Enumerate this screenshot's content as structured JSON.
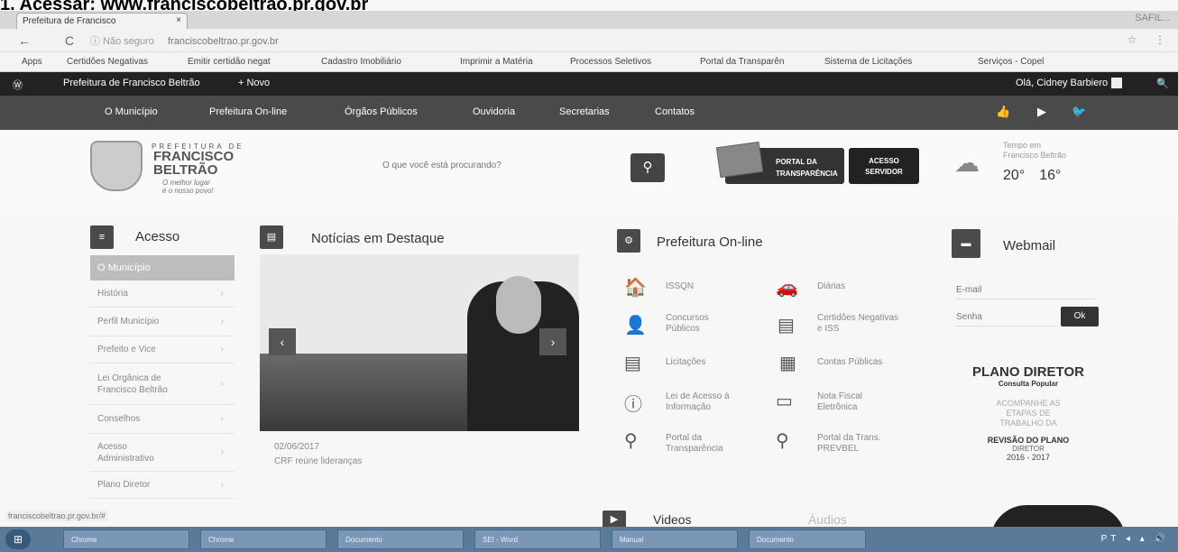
{
  "instruction": {
    "step": "1. Acessar:",
    "url": "www.franciscobeltrao.pr.gov.br"
  },
  "browser": {
    "tab_title": "Prefeitura de Francisco",
    "tab_close": "×",
    "window_user": "SAFIL...",
    "back": "←",
    "reload": "C",
    "security": "ⓘ Não seguro",
    "url": "franciscobeltrao.pr.gov.br",
    "right_icons": "☆ ⋮",
    "bookmarks": [
      "Apps",
      "Certidões Negativas",
      "Emitir certidão negat",
      "Cadastro Imobiliário",
      "Imprimir a Matéria",
      "Processos Seletivos",
      "Portal da Transparên",
      "Sistema de Licitações",
      "Serviços - Copel"
    ]
  },
  "adminbar": {
    "site": "Prefeitura de Francisco Beltrão",
    "new": "+ Novo",
    "greeting": "Olá, Cidney Barbiero",
    "search_icon": "🔍"
  },
  "nav": {
    "items": [
      "O Município",
      "Prefeitura On-line",
      "Órgãos Públicos",
      "Ouvidoria",
      "Secretarias",
      "Contatos"
    ],
    "social": [
      "👍",
      "▶",
      "🐦"
    ]
  },
  "header": {
    "logo_top": "PREFEITURA DE",
    "logo_name_1": "FRANCISCO",
    "logo_name_2": "BELTRÃO",
    "slogan_1": "O melhor lugar",
    "slogan_2": "é o nosso povo!",
    "search_placeholder": "O que você está procurando?",
    "portal_1": "PORTAL DA",
    "portal_2": "TRANSPARÊNCIA",
    "acesso_1": "ACESSO",
    "acesso_2": "SERVIDOR",
    "weather_l1": "Tempo em",
    "weather_l2": "Francisco Beltrão",
    "temp_max": "20°",
    "temp_min": "16°"
  },
  "acesso": {
    "title": "Acesso",
    "active": "O Município",
    "items": [
      "História",
      "Perfil Município",
      "Prefeito e Vice",
      "Lei Orgânica de Francisco Beltrão",
      "Conselhos",
      "Acesso Administrativo",
      "Plano Diretor"
    ]
  },
  "noticias": {
    "title": "Notícias em Destaque",
    "date": "02/06/2017",
    "caption": "CRF reúne lideranças"
  },
  "online": {
    "title": "Prefeitura On-line",
    "services": [
      "ISSQN",
      "Concursos Públicos",
      "Licitações",
      "Lei de Acesso à Informação",
      "Portal da Transparência",
      "Diárias",
      "Certidões Negativas e ISS",
      "Contas Públicas",
      "Nota Fiscal Eletrônica",
      "Portal da Trans. PREVBEL"
    ]
  },
  "webmail": {
    "title": "Webmail",
    "email_ph": "E-mail",
    "senha_ph": "Senha",
    "ok": "Ok"
  },
  "plano": {
    "title": "PLANO DIRETOR",
    "sub": "Consulta Popular",
    "acompanhe_1": "ACOMPANHE AS",
    "acompanhe_2": "ETAPAS DE",
    "acompanhe_3": "TRABALHO DA",
    "revisao": "REVISÃO DO PLANO",
    "diretor": "DIRETOR",
    "years": "2016 - 2017"
  },
  "bottom": {
    "status_url": "franciscobeltrao.pr.gov.br/#",
    "videos": "Videos",
    "audios": "Áudios"
  },
  "taskbar": {
    "items": [
      "Chrome",
      "Chrome",
      "Documento",
      "SEI - Word",
      "Manual",
      "Documento"
    ],
    "tray": "PT ◂ ▴ 🔊"
  }
}
